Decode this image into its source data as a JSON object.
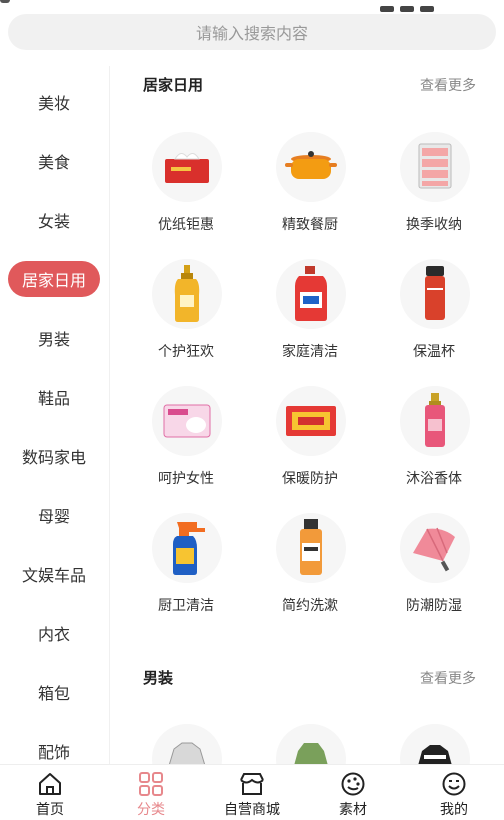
{
  "search": {
    "placeholder": "请输入搜索内容"
  },
  "sidebar": {
    "items": [
      {
        "label": "美妆"
      },
      {
        "label": "美食"
      },
      {
        "label": "女装"
      },
      {
        "label": "居家日用"
      },
      {
        "label": "男装"
      },
      {
        "label": "鞋品"
      },
      {
        "label": "数码家电"
      },
      {
        "label": "母婴"
      },
      {
        "label": "文娱车品"
      },
      {
        "label": "内衣"
      },
      {
        "label": "箱包"
      },
      {
        "label": "配饰"
      }
    ],
    "active_label": "居家日用",
    "active_color": "#e0595b"
  },
  "sections": [
    {
      "title": "居家日用",
      "more": "查看更多",
      "items": [
        {
          "label": "优纸钜惠",
          "icon": "tissue-box-icon"
        },
        {
          "label": "精致餐厨",
          "icon": "cooking-pot-icon"
        },
        {
          "label": "换季收纳",
          "icon": "storage-drawers-icon"
        },
        {
          "label": "个护狂欢",
          "icon": "shampoo-bottle-icon"
        },
        {
          "label": "家庭清洁",
          "icon": "detergent-bottle-icon"
        },
        {
          "label": "保温杯",
          "icon": "thermos-icon"
        },
        {
          "label": "呵护女性",
          "icon": "sanitary-pad-icon"
        },
        {
          "label": "保暖防护",
          "icon": "heat-pack-icon"
        },
        {
          "label": "沐浴香体",
          "icon": "body-mist-icon"
        },
        {
          "label": "厨卫清洁",
          "icon": "spray-cleaner-icon"
        },
        {
          "label": "简约洗漱",
          "icon": "mouthwash-icon"
        },
        {
          "label": "防潮防湿",
          "icon": "umbrella-icon"
        }
      ]
    },
    {
      "title": "男装",
      "more": "查看更多"
    }
  ],
  "tabbar": {
    "items": [
      {
        "label": "首页",
        "icon": "home-icon"
      },
      {
        "label": "分类",
        "icon": "category-grid-icon"
      },
      {
        "label": "自营商城",
        "icon": "store-icon"
      },
      {
        "label": "素材",
        "icon": "palette-icon"
      },
      {
        "label": "我的",
        "icon": "smile-face-icon"
      }
    ],
    "active_label": "分类",
    "active_color": "#e7888c"
  }
}
